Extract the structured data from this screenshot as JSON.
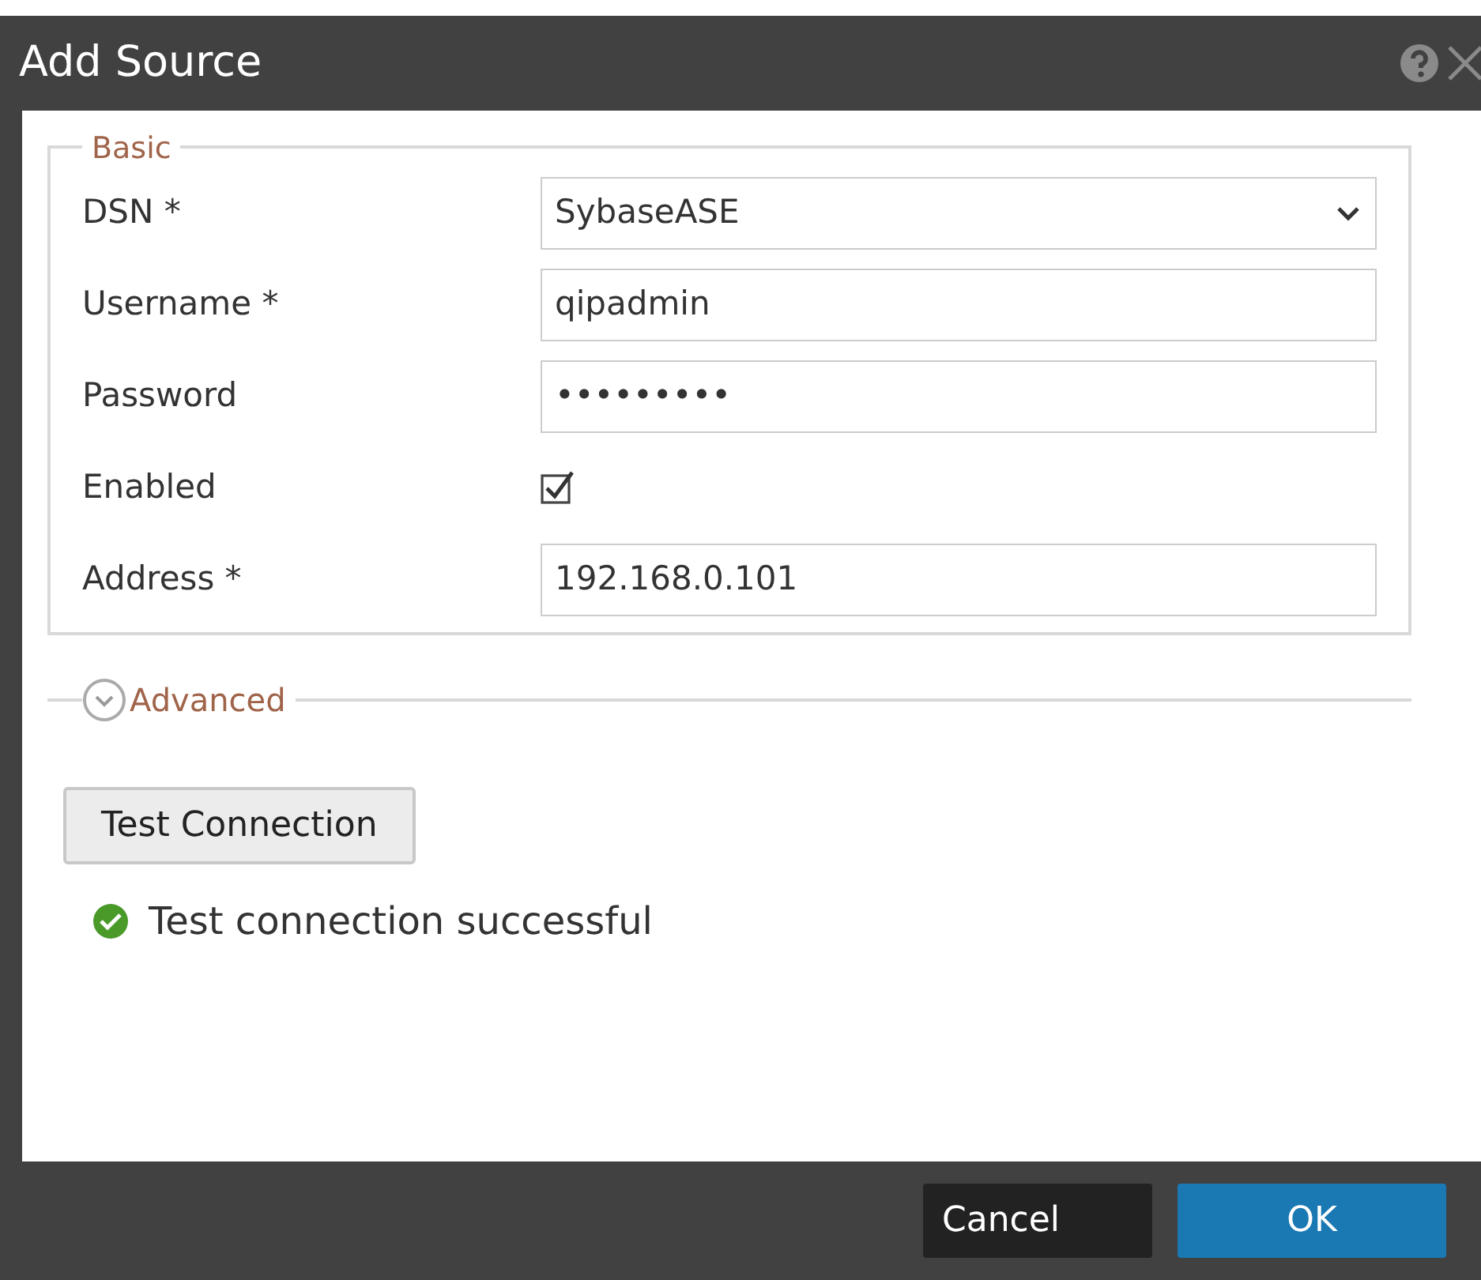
{
  "window": {
    "title": "Add Source"
  },
  "basic": {
    "legend": "Basic",
    "fields": [
      {
        "kind": "select",
        "label": "DSN *",
        "value": "SybaseASE"
      },
      {
        "kind": "text",
        "label": "Username *",
        "value": "qipadmin"
      },
      {
        "kind": "password",
        "label": "Password",
        "value": "•••••••••"
      },
      {
        "kind": "checkbox",
        "label": "Enabled",
        "checked": true
      },
      {
        "kind": "text",
        "label": "Address *",
        "value": "192.168.0.101"
      }
    ]
  },
  "advanced": {
    "label": "Advanced",
    "expanded": false
  },
  "test_button": "Test Connection",
  "status": {
    "text": "Test connection successful"
  },
  "buttons": [
    {
      "kind": "secondary",
      "label": "Cancel"
    },
    {
      "kind": "primary",
      "label": "OK"
    }
  ]
}
